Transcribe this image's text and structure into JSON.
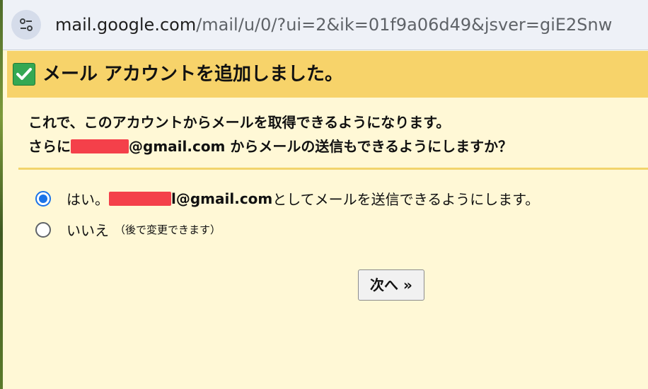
{
  "browser": {
    "url_host": "mail.google.com",
    "url_path": "/mail/u/0/?ui=2&ik=01f9a06d49&jsver=giE2Snw"
  },
  "header": {
    "title": "メール アカウントを追加しました。"
  },
  "intro": {
    "line1": "これで、このアカウントからメールを取得できるようになります。",
    "line2_prefix": "さらに",
    "line2_email_suffix": "@gmail.com",
    "line2_rest": " からメールの送信もできるようにしますか？"
  },
  "options": {
    "yes_prefix": "はい。",
    "yes_email_suffix": "l@gmail.com",
    "yes_rest": " としてメールを送信できるようにします。",
    "no_label": "いいえ",
    "no_note": "（後で変更できます）",
    "selected": "yes"
  },
  "buttons": {
    "next_label": "次へ »"
  },
  "colors": {
    "header_bg": "#f7d36a",
    "panel_bg": "#fff8d6",
    "radio_selected": "#1a73e8",
    "redaction": "#f4404a"
  }
}
